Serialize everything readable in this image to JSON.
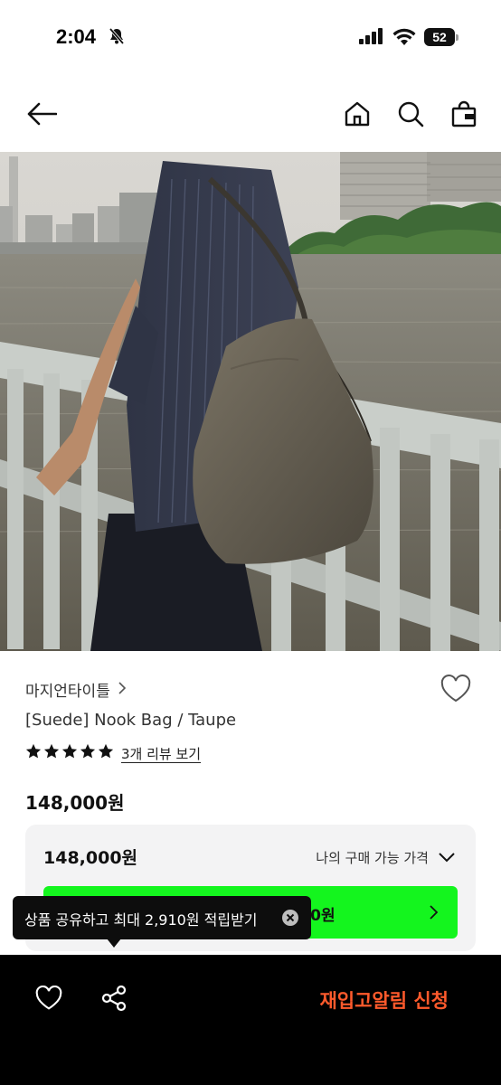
{
  "status_bar": {
    "time": "2:04",
    "battery": "52"
  },
  "header": {
    "back_icon": "arrow-left-icon",
    "home_icon": "home-icon",
    "search_icon": "search-icon",
    "cart_icon": "shopping-bag-icon"
  },
  "product": {
    "brand": "마지언타이틀",
    "title": "[Suede] Nook Bag / Taupe",
    "rating_stars": 5,
    "review_link": "3개 리뷰 보기",
    "price": "148,000원"
  },
  "price_box": {
    "price": "148,000원",
    "label": "나의 구매 가능 가격",
    "button_text_visible": "00원"
  },
  "tooltip": {
    "text": "상품 공유하고 최대 2,910원 적립받기"
  },
  "bottom_bar": {
    "restock_label": "재입고알림 신청"
  },
  "colors": {
    "accent_green": "#14f51e",
    "restock_orange": "#ff5a2c",
    "bar_black": "#000000"
  }
}
